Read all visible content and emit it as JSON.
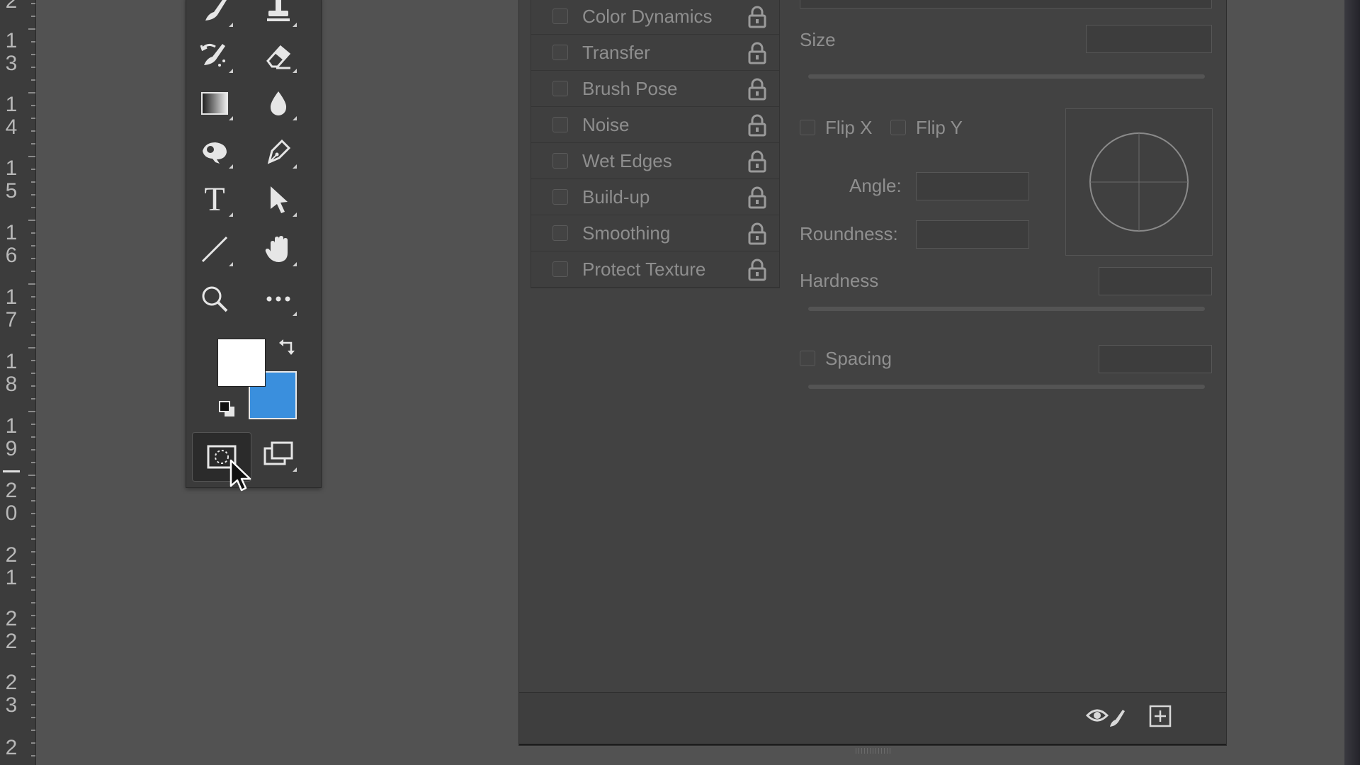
{
  "ruler": {
    "labels": [
      "2",
      "1\n3",
      "1\n4",
      "1\n5",
      "1\n6",
      "1\n7",
      "1\n8",
      "1\n9",
      "2\n0",
      "2\n1",
      "2\n2",
      "2\n3",
      "2"
    ]
  },
  "toolbar": {
    "tools": [
      {
        "name": "brush-tool",
        "icon": "brush-icon"
      },
      {
        "name": "clone-stamp-tool",
        "icon": "stamp-icon"
      },
      {
        "name": "history-brush-tool",
        "icon": "history-brush-icon"
      },
      {
        "name": "eraser-tool",
        "icon": "eraser-icon"
      },
      {
        "name": "gradient-tool",
        "icon": "gradient-icon"
      },
      {
        "name": "blur-tool",
        "icon": "drop-icon"
      },
      {
        "name": "dodge-tool",
        "icon": "dodge-icon"
      },
      {
        "name": "pen-tool",
        "icon": "pen-icon"
      },
      {
        "name": "type-tool",
        "icon": "type-icon"
      },
      {
        "name": "path-selection-tool",
        "icon": "arrow-icon"
      },
      {
        "name": "line-tool",
        "icon": "line-icon"
      },
      {
        "name": "hand-tool",
        "icon": "hand-icon"
      },
      {
        "name": "zoom-tool",
        "icon": "magnifier-icon"
      },
      {
        "name": "edit-toolbar",
        "icon": "ellipsis-icon"
      }
    ],
    "foreground_color": "#ffffff",
    "background_color": "#3a8fdd",
    "type_glyph": "T"
  },
  "brush_settings": {
    "list_items": [
      {
        "label": "Color Dynamics"
      },
      {
        "label": "Transfer"
      },
      {
        "label": "Brush Pose"
      },
      {
        "label": "Noise"
      },
      {
        "label": "Wet Edges"
      },
      {
        "label": "Build-up"
      },
      {
        "label": "Smoothing"
      },
      {
        "label": "Protect Texture"
      }
    ],
    "size_label": "Size",
    "flip_x_label": "Flip X",
    "flip_y_label": "Flip Y",
    "angle_label": "Angle:",
    "roundness_label": "Roundness:",
    "hardness_label": "Hardness",
    "spacing_label": "Spacing"
  },
  "colors": {
    "ui_background": "#525252",
    "panel": "#424242",
    "accent_blue": "#3a8fdd"
  }
}
